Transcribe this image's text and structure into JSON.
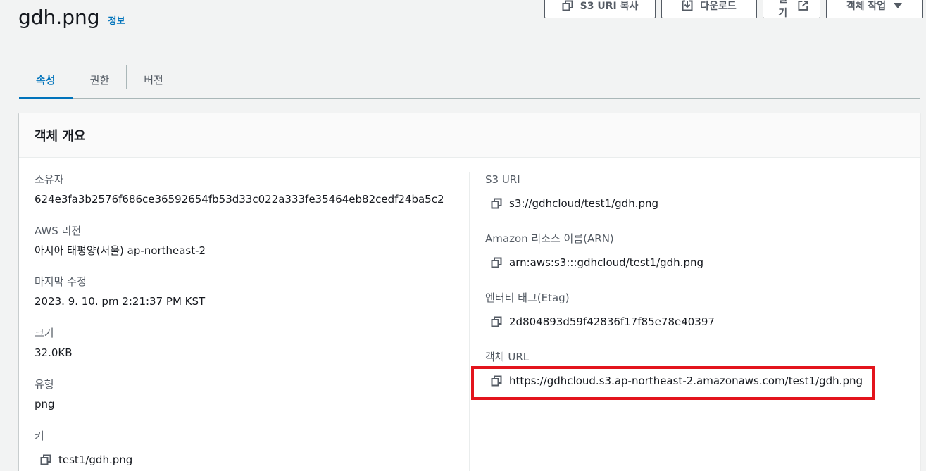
{
  "header": {
    "title": "gdh.png",
    "info_label": "정보"
  },
  "toolbar": {
    "copy_s3_uri_label": "S3 URI 복사",
    "download_label": "다운로드",
    "open_label": "열기",
    "object_actions_label": "객체 작업"
  },
  "tabs": [
    {
      "label": "속성",
      "active": true
    },
    {
      "label": "권한",
      "active": false
    },
    {
      "label": "버전",
      "active": false
    }
  ],
  "overview": {
    "title": "객체 개요",
    "left": {
      "owner": {
        "label": "소유자",
        "value": "624e3fa3b2576f686ce36592654fb53d33c022a333fe35464eb82cedf24ba5c2"
      },
      "region": {
        "label": "AWS 리전",
        "value": "아시아 태평양(서울) ap-northeast-2"
      },
      "last_modified": {
        "label": "마지막 수정",
        "value": "2023. 9. 10. pm 2:21:37 PM KST"
      },
      "size": {
        "label": "크기",
        "value": "32.0KB"
      },
      "type": {
        "label": "유형",
        "value": "png"
      },
      "key": {
        "label": "키",
        "value": "test1/gdh.png"
      }
    },
    "right": {
      "s3_uri": {
        "label": "S3 URI",
        "value": "s3://gdhcloud/test1/gdh.png"
      },
      "arn": {
        "label": "Amazon 리소스 이름(ARN)",
        "value": "arn:aws:s3:::gdhcloud/test1/gdh.png"
      },
      "etag": {
        "label": "엔터티 태그(Etag)",
        "value": "2d804893d59f42836f17f85e78e40397"
      },
      "object_url": {
        "label": "객체 URL",
        "value": "https://gdhcloud.s3.ap-northeast-2.amazonaws.com/test1/gdh.png"
      }
    }
  },
  "colors": {
    "accent": "#0073bb",
    "highlight": "#e3141c",
    "text": "#16191f",
    "muted": "#545b64"
  },
  "icons": {
    "copy": "copy-icon",
    "download": "download-icon",
    "external": "external-link-icon",
    "caret": "caret-down-icon"
  }
}
